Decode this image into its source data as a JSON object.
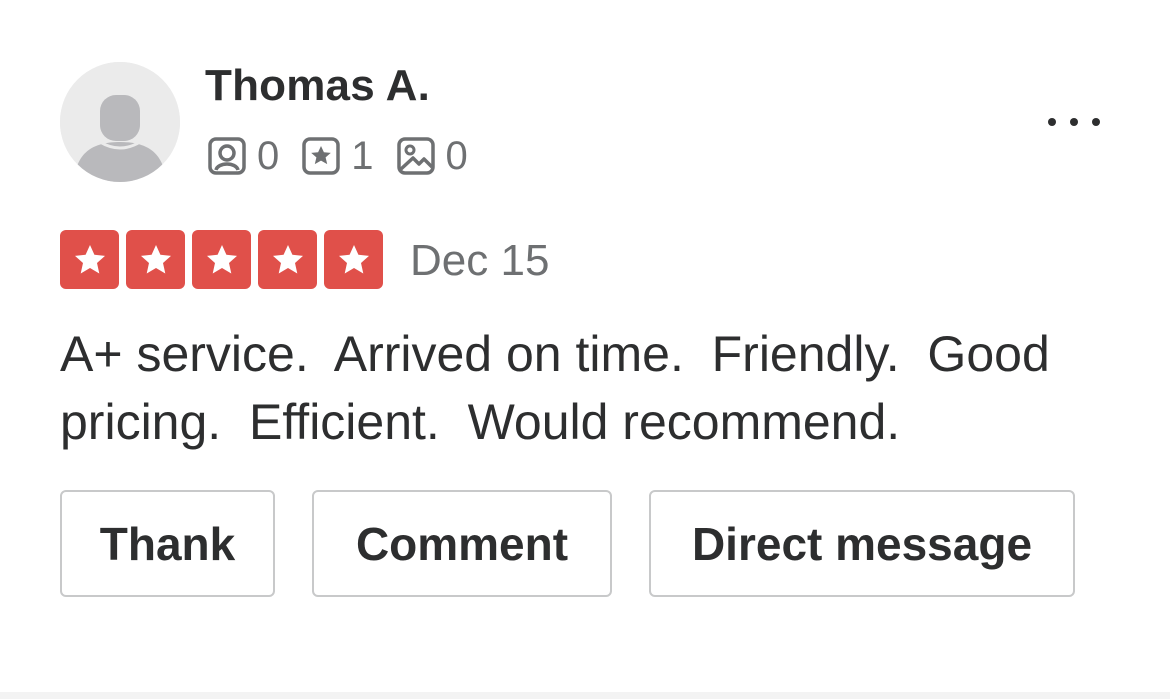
{
  "review": {
    "user": {
      "name": "Thomas A.",
      "avatar_icon": "default-user-avatar-icon",
      "stats": {
        "friends": {
          "icon": "friends-icon",
          "value": "0"
        },
        "reviews": {
          "icon": "reviews-star-icon",
          "value": "1"
        },
        "photos": {
          "icon": "photos-icon",
          "value": "0"
        }
      }
    },
    "more_icon": "more-options-icon",
    "rating": {
      "stars": 5,
      "max": 5,
      "color": "#e0504a"
    },
    "date": "Dec 15",
    "text": "A+ service.  Arrived on time.  Friendly.  Good pricing.  Efficient.  Would recommend.",
    "actions": {
      "thank": "Thank",
      "comment": "Comment",
      "direct_message": "Direct message"
    }
  },
  "colors": {
    "text_primary": "#2d2e2f",
    "text_secondary": "#6e7072",
    "star_red": "#e0504a",
    "button_border": "#c8c9ca",
    "avatar_bg": "#ebebeb",
    "avatar_fg": "#b9b9bc"
  }
}
